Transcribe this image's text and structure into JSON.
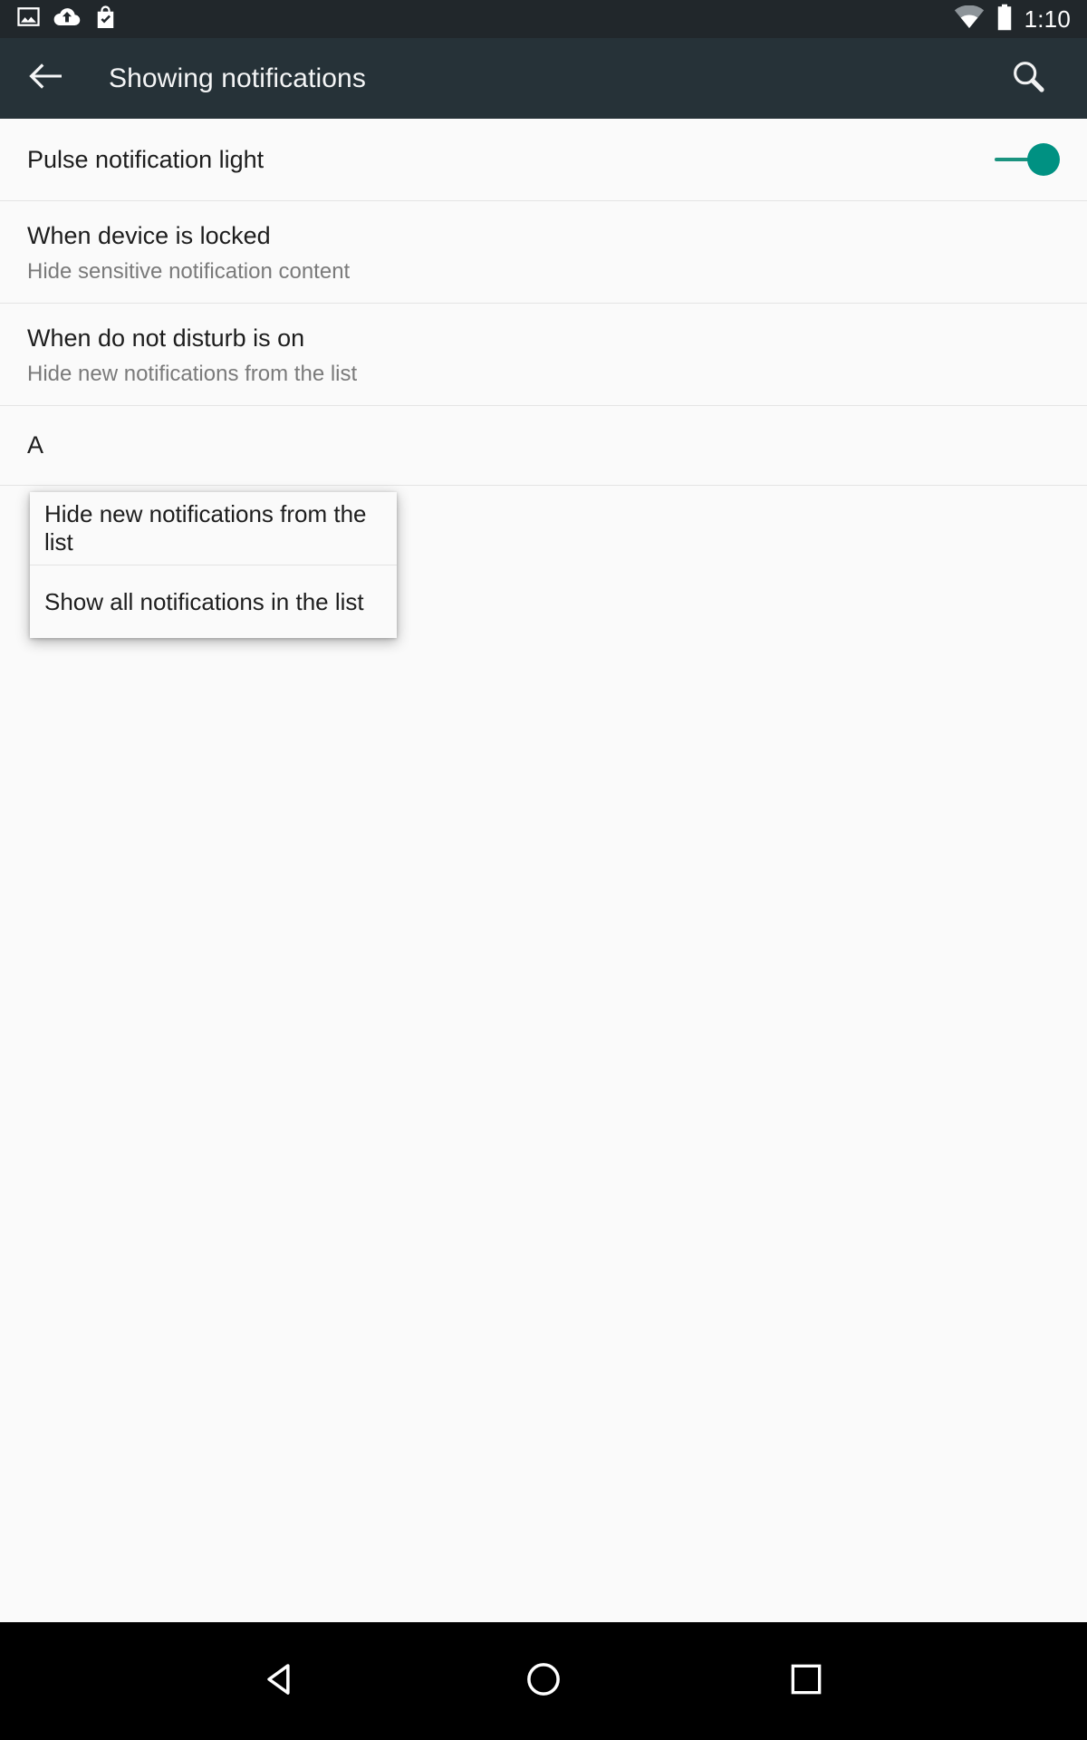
{
  "status_bar": {
    "time": "1:10",
    "left_icons": [
      "image-icon",
      "cloud-upload-icon",
      "play-store-bag-icon"
    ],
    "right_icons": [
      "wifi-icon",
      "battery-icon"
    ],
    "background_color": "#21272b"
  },
  "toolbar": {
    "title": "Showing notifications",
    "back_icon": "back-arrow-icon",
    "search_icon": "search-icon",
    "background_color": "#263238"
  },
  "settings": {
    "items": [
      {
        "title": "Pulse notification light",
        "subtitle": "",
        "control": "switch",
        "switch_on": true,
        "switch_color": "#009182"
      },
      {
        "title": "When device is locked",
        "subtitle": "Hide sensitive notification content",
        "control": "none"
      },
      {
        "title": "When do not disturb is on",
        "subtitle": "Hide new notifications from the list",
        "control": "none"
      },
      {
        "title": "A",
        "subtitle": "",
        "control": "none"
      }
    ]
  },
  "popup_menu": {
    "options": [
      "Hide new notifications from the list",
      "Show all notifications in the list"
    ],
    "selected": "Hide new notifications from the list"
  },
  "nav_bar": {
    "buttons": [
      "back-triangle-icon",
      "home-circle-icon",
      "recents-square-icon"
    ],
    "background_color": "#000000"
  }
}
